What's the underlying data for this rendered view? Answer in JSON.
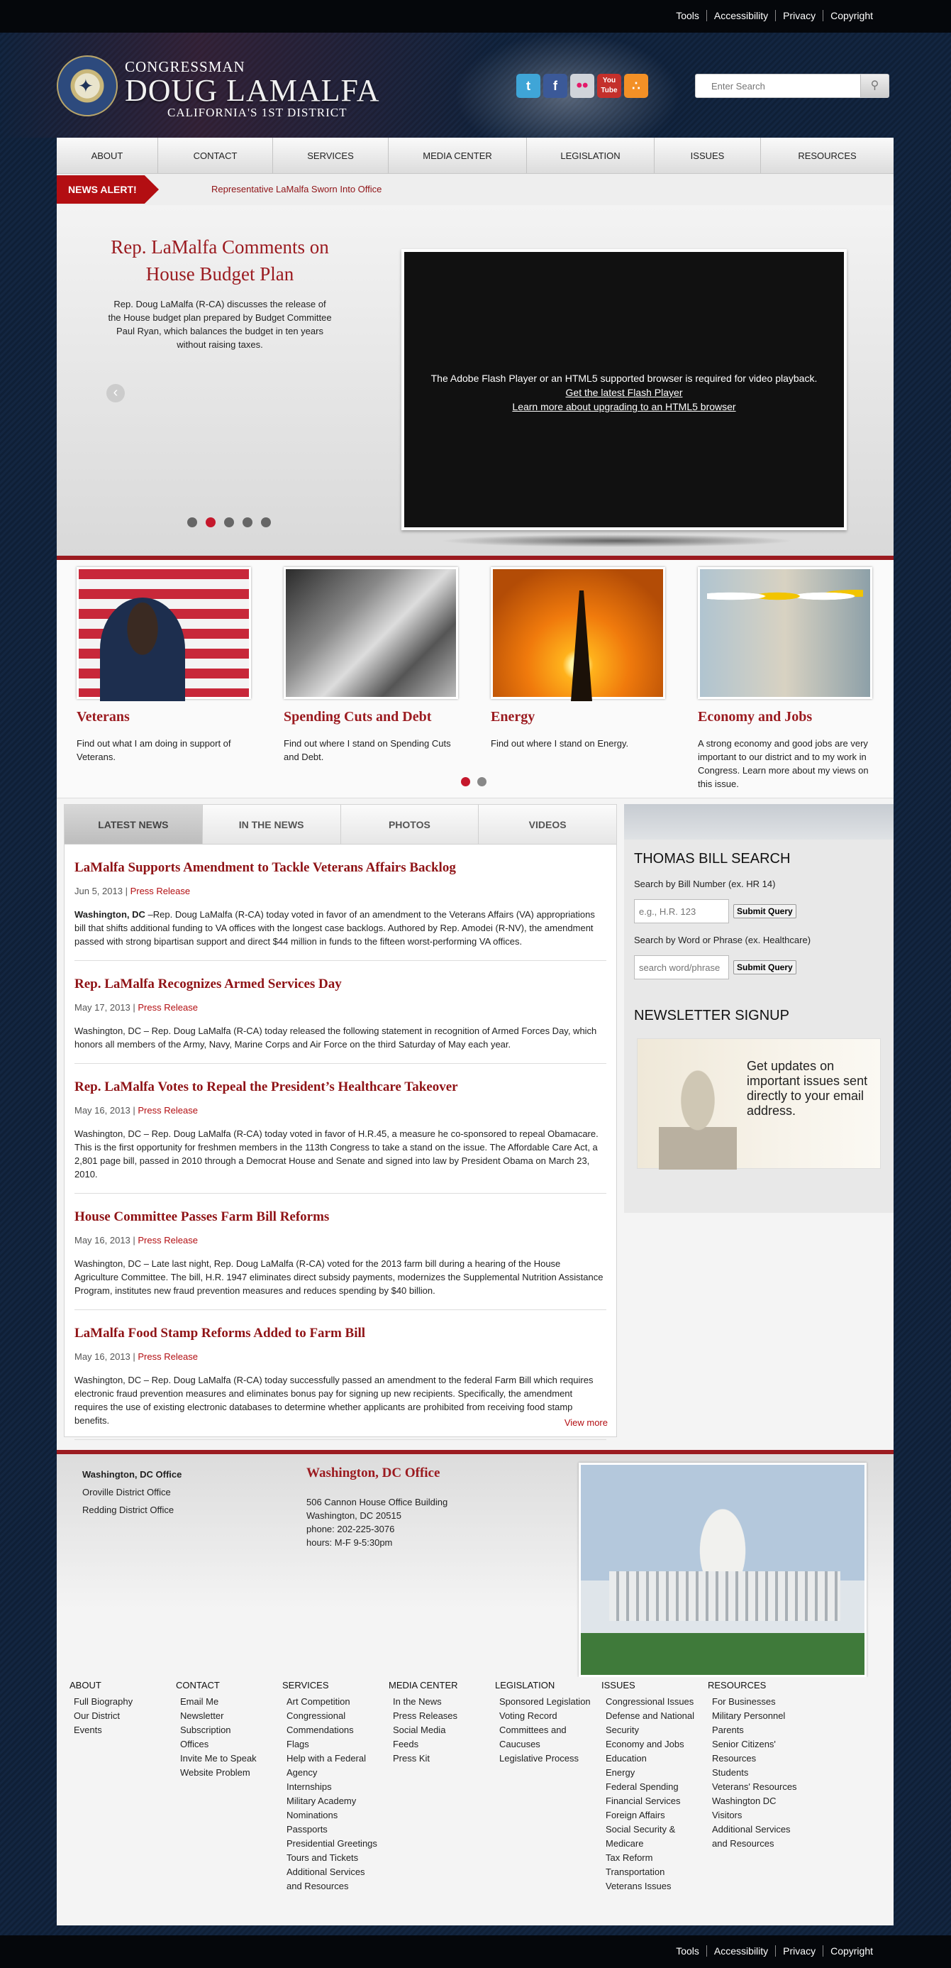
{
  "util_links": [
    "Tools",
    "Accessibility",
    "Privacy",
    "Copyright"
  ],
  "header": {
    "congressman": "CONGRESSMAN",
    "name": "DOUG LAMALFA",
    "district": "CALIFORNIA'S 1ST DISTRICT",
    "search_placeholder": "Enter Search"
  },
  "social": [
    "twitter",
    "facebook",
    "flickr",
    "youtube",
    "rss"
  ],
  "nav": [
    "ABOUT",
    "CONTACT",
    "SERVICES",
    "MEDIA CENTER",
    "LEGISLATION",
    "ISSUES",
    "RESOURCES"
  ],
  "alert": {
    "tag": "NEWS ALERT!",
    "text": "Representative LaMalfa Sworn Into Office"
  },
  "hero": {
    "title": "Rep. LaMalfa Comments on House Budget Plan",
    "text": "Rep. Doug LaMalfa (R-CA) discusses the release of the House budget plan prepared by Budget Committee Paul Ryan, which balances the budget in ten years without raising taxes.",
    "video_message": "The Adobe Flash Player or an HTML5 supported browser is required for video playback.",
    "video_link1": "Get the latest Flash Player",
    "video_link2": "Learn more about upgrading to an HTML5 browser",
    "active_dot": 2,
    "dot_count": 5
  },
  "features": [
    {
      "title": "Veterans",
      "text": "Find out what I am doing in support of Veterans."
    },
    {
      "title": "Spending Cuts and Debt",
      "text": "Find out where I stand on Spending Cuts and Debt."
    },
    {
      "title": "Energy",
      "text": "Find out where I stand on Energy."
    },
    {
      "title": "Economy and Jobs",
      "text": "A strong economy and good jobs are very important to our district and to my work in Congress. Learn more about my views on this issue."
    }
  ],
  "tabs": [
    "LATEST NEWS",
    "IN THE NEWS",
    "PHOTOS",
    "VIDEOS"
  ],
  "articles": [
    {
      "title": "LaMalfa Supports Amendment to Tackle Veterans Affairs Backlog",
      "date": "Jun 5, 2013",
      "type": "Press Release",
      "lead": "Washington, DC",
      "body": " –Rep. Doug LaMalfa (R-CA) today voted in favor of an amendment to the Veterans Affairs (VA) appropriations bill that shifts additional funding to VA offices with the longest case backlogs. Authored by Rep. Amodei (R-NV), the amendment passed with strong bipartisan support and direct $44 million in funds to the fifteen worst-performing VA offices."
    },
    {
      "title": "Rep. LaMalfa Recognizes Armed Services Day",
      "date": "May 17, 2013",
      "type": "Press Release",
      "lead": "",
      "body": "Washington, DC – Rep. Doug LaMalfa (R-CA) today released the following statement in recognition of Armed Forces Day, which honors all members of the Army, Navy, Marine Corps and Air Force on the third Saturday of May each year."
    },
    {
      "title": "Rep. LaMalfa Votes to Repeal the President’s Healthcare Takeover",
      "date": "May 16, 2013",
      "type": "Press Release",
      "lead": "",
      "body": "Washington, DC – Rep. Doug LaMalfa (R-CA) today voted in favor of H.R.45, a measure he co-sponsored to repeal Obamacare. This is the first opportunity for freshmen members in the 113th Congress to take a stand on the issue. The Affordable Care Act, a 2,801 page bill, passed in 2010 through a Democrat House and Senate and signed into law by President Obama on March 23, 2010."
    },
    {
      "title": "House Committee Passes Farm Bill Reforms",
      "date": "May 16, 2013",
      "type": "Press Release",
      "lead": "",
      "body": "Washington, DC – Late last night, Rep. Doug LaMalfa (R-CA) voted for the 2013 farm bill during a hearing of the House Agriculture Committee. The bill, H.R. 1947 eliminates direct subsidy payments, modernizes the Supplemental Nutrition Assistance Program, institutes new fraud prevention measures and reduces spending by $40 billion."
    },
    {
      "title": "LaMalfa Food Stamp Reforms Added to Farm Bill",
      "date": "May 16, 2013",
      "type": "Press Release",
      "lead": "",
      "body": "Washington, DC – Rep. Doug LaMalfa (R-CA) today successfully passed an amendment to the federal Farm Bill which requires electronic fraud prevention measures and eliminates bonus pay for signing up new recipients. Specifically, the amendment requires the use of existing electronic databases to determine whether applicants are prohibited from receiving food stamp benefits."
    }
  ],
  "view_more": "View more",
  "bill_search": {
    "title": "THOMAS BILL SEARCH",
    "label1": "Search by Bill Number (ex. HR 14)",
    "placeholder1": "e.g., H.R. 123",
    "label2": "Search by Word or Phrase (ex. Healthcare)",
    "placeholder2": "search word/phrase",
    "submit": "Submit Query"
  },
  "newsletter": {
    "title": "NEWSLETTER SIGNUP",
    "text": "Get updates on important issues sent directly to your email address."
  },
  "offices": {
    "list": [
      "Washington, DC Office",
      "Oroville District Office",
      "Redding District Office"
    ],
    "active_title": "Washington, DC Office",
    "address1": "506 Cannon House Office Building",
    "address2": "Washington, DC 20515",
    "phone": "phone: 202-225-3076",
    "hours": "hours: M-F 9-5:30pm"
  },
  "sitemap": [
    {
      "heading": "ABOUT",
      "links": [
        "Full Biography",
        "Our District",
        "Events"
      ]
    },
    {
      "heading": "CONTACT",
      "links": [
        "Email Me",
        "Newsletter Subscription",
        "Offices",
        "Invite Me to Speak",
        "Website Problem"
      ]
    },
    {
      "heading": "SERVICES",
      "links": [
        "Art Competition",
        "Congressional Commendations",
        "Flags",
        "Help with a Federal Agency",
        "Internships",
        "Military Academy Nominations",
        "Passports",
        "Presidential Greetings",
        "Tours and Tickets",
        "Additional Services and Resources"
      ]
    },
    {
      "heading": "MEDIA CENTER",
      "links": [
        "In the News",
        "Press Releases",
        "Social Media",
        "Feeds",
        "Press Kit"
      ]
    },
    {
      "heading": "LEGISLATION",
      "links": [
        "Sponsored Legislation",
        "Voting Record",
        "Committees and Caucuses",
        "Legislative Process"
      ]
    },
    {
      "heading": "ISSUES",
      "links": [
        "Congressional Issues",
        "Defense and National Security",
        "Economy and Jobs",
        "Education",
        "Energy",
        "Federal Spending",
        "Financial Services",
        "Foreign Affairs",
        "Social Security & Medicare",
        "Tax Reform",
        "Transportation",
        "Veterans Issues"
      ]
    },
    {
      "heading": "RESOURCES",
      "links": [
        "For Businesses",
        "Military Personnel",
        "Parents",
        "Senior Citizens' Resources",
        "Students",
        "Veterans' Resources",
        "Washington DC Visitors",
        "Additional Services and Resources"
      ]
    }
  ],
  "colors": {
    "accent_red": "#9b1b20",
    "alert_red": "#b30e12",
    "background_navy": "#12233d"
  }
}
